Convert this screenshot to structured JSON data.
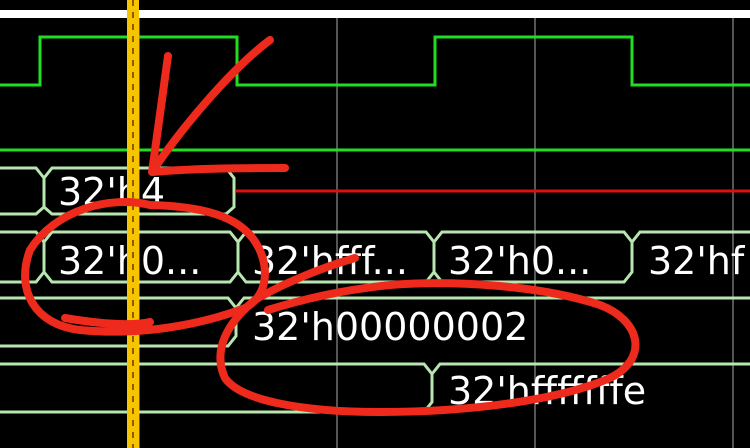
{
  "colors": {
    "background": "#000000",
    "top_border": "#ffffff",
    "clock": "#22dd22",
    "bus": "#b8e6b0",
    "undefined_signal": "#dd1111",
    "grid": "#555555",
    "cursor": "#f7c400",
    "cursor_edge": "#6b3a00",
    "annotation": "#ee2a1c"
  },
  "rows": {
    "row_a": {
      "partial_label": "32'h4",
      "trailing_state": "undefined"
    },
    "row_b": {
      "segments": [
        "32'h0...",
        "32'hfff...",
        "32'h0...",
        "32'hf"
      ]
    },
    "row_c": {
      "value": "32'h00000002"
    },
    "row_d": {
      "value": "32'hfffffffe"
    }
  },
  "annotation": {
    "type": "freehand-marker",
    "elements": [
      "arrow",
      "circle",
      "circle"
    ]
  }
}
